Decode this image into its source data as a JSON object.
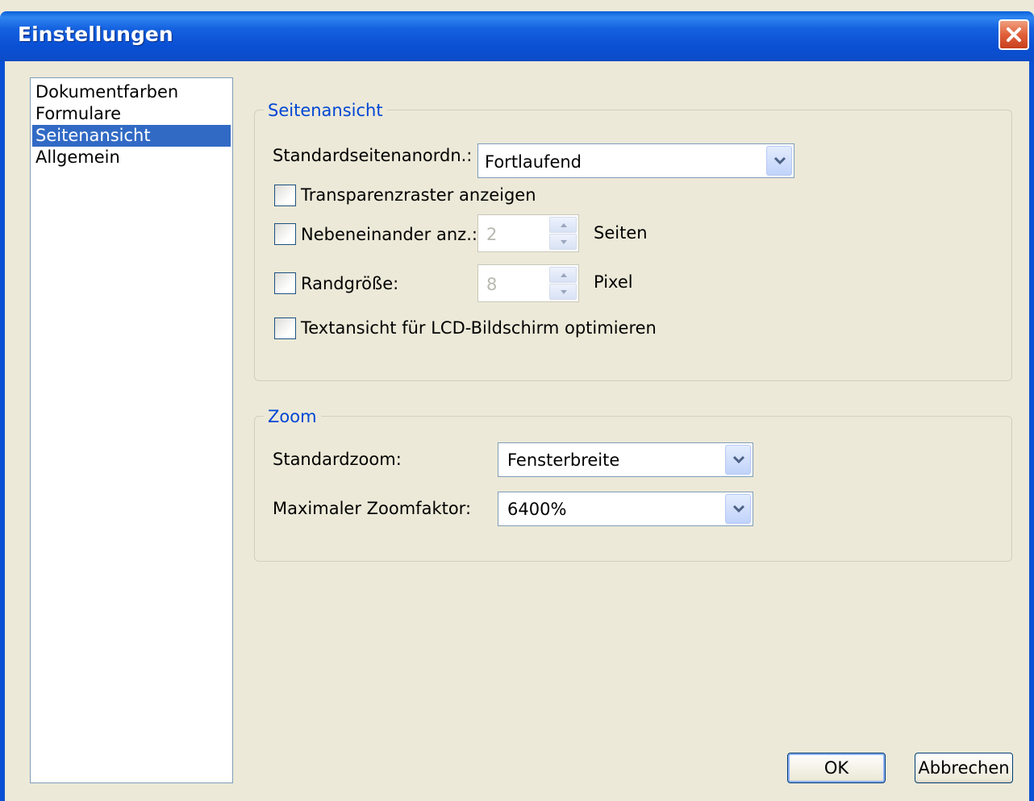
{
  "window": {
    "title": "Einstellungen"
  },
  "nav": {
    "items": [
      {
        "label": "Dokumentfarben",
        "selected": false
      },
      {
        "label": "Formulare",
        "selected": false
      },
      {
        "label": "Seitenansicht",
        "selected": true
      },
      {
        "label": "Allgemein",
        "selected": false
      }
    ]
  },
  "seitenansicht": {
    "legend": "Seitenansicht",
    "layout_label": "Standardseitenanordn.:",
    "layout_value": "Fortlaufend",
    "transparency_label": "Transparenzraster anzeigen",
    "transparency_checked": false,
    "side_by_side_label": "Nebeneinander anz.:",
    "side_by_side_checked": false,
    "side_by_side_value": "2",
    "side_by_side_unit": "Seiten",
    "border_label": "Randgröße:",
    "border_checked": false,
    "border_value": "8",
    "border_unit": "Pixel",
    "lcd_label": "Textansicht für LCD-Bildschirm optimieren",
    "lcd_checked": false
  },
  "zoom": {
    "legend": "Zoom",
    "default_label": "Standardzoom:",
    "default_value": "Fensterbreite",
    "max_label": "Maximaler Zoomfaktor:",
    "max_value": "6400%"
  },
  "buttons": {
    "ok": "OK",
    "cancel": "Abbrechen"
  },
  "icons": {
    "close": "close-icon",
    "dropdown": "chevron-down-icon",
    "spin_up": "arrow-up-icon",
    "spin_down": "arrow-down-icon"
  }
}
